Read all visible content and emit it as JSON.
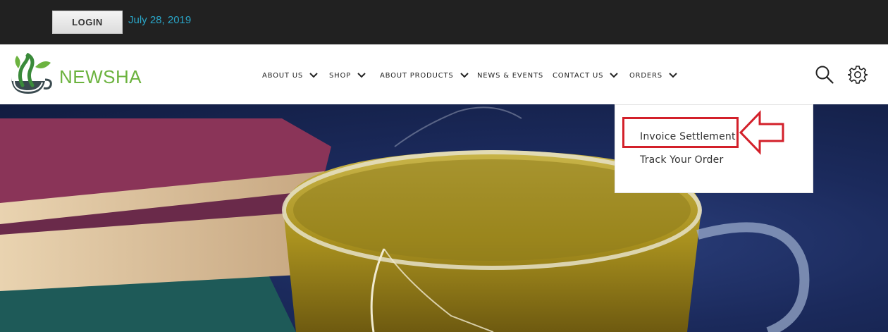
{
  "topbar": {
    "login_label": "LOGIN",
    "date": "July 28, 2019"
  },
  "header": {
    "logo_text": "NEWSHA",
    "nav": [
      {
        "label": "ABOUT US",
        "has_dropdown": true
      },
      {
        "label": "SHOP",
        "has_dropdown": true
      },
      {
        "label": "ABOUT PRODUCTS",
        "has_dropdown": true
      },
      {
        "label": "NEWS & EVENTS",
        "has_dropdown": false
      },
      {
        "label": "CONTACT US",
        "has_dropdown": true
      },
      {
        "label": "ORDERS",
        "has_dropdown": true
      }
    ],
    "icons": [
      "search-icon",
      "gear-icon"
    ]
  },
  "dropdown": {
    "items": [
      {
        "label": "Invoice Settlement",
        "highlighted": true
      },
      {
        "label": "Track Your Order",
        "highlighted": false
      }
    ]
  },
  "colors": {
    "topbar_bg": "#212121",
    "date_color": "#2aa6c8",
    "brand_green": "#6cb33f",
    "highlight_red": "#d3202a"
  }
}
